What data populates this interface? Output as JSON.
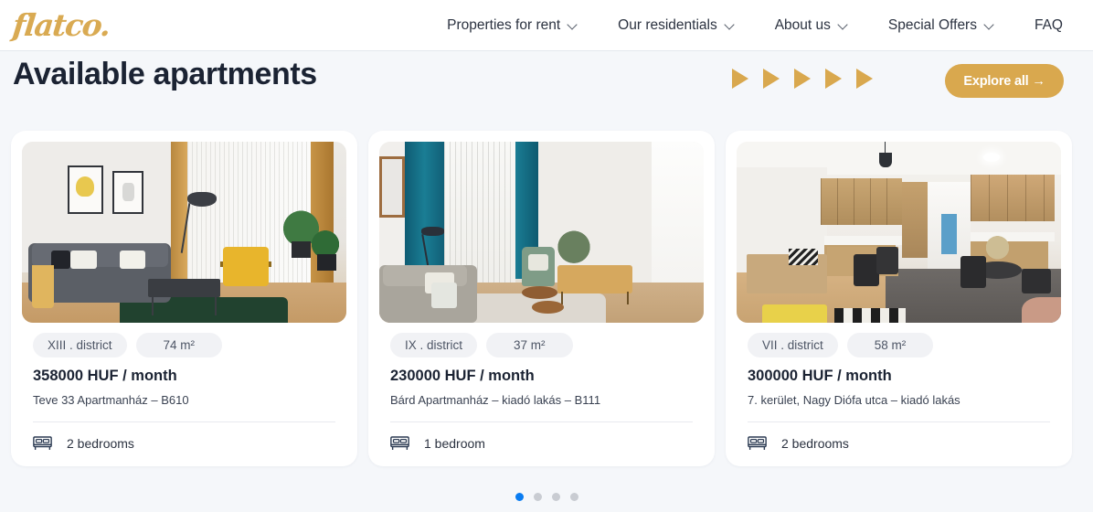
{
  "brand": {
    "logo_text": "flatco."
  },
  "nav": {
    "items": [
      {
        "label": "Properties for rent",
        "has_chevron": true
      },
      {
        "label": "Our residentials",
        "has_chevron": true
      },
      {
        "label": "About us",
        "has_chevron": true
      },
      {
        "label": "Special Offers",
        "has_chevron": true
      },
      {
        "label": "FAQ",
        "has_chevron": false
      }
    ]
  },
  "header": {
    "title": "Available apartments",
    "explore_label": "Explore all →",
    "arrow_count": 5,
    "accent_color": "#d9a84e"
  },
  "cards": [
    {
      "district": "XIII . district",
      "area": "74 m²",
      "price": "358000 HUF / month",
      "subtitle": "Teve 33 Apartmanház – B610",
      "bedrooms": "2 bedrooms",
      "photo_alt": "living room with gray sofa and yellow armchair"
    },
    {
      "district": "IX . district",
      "area": "37 m²",
      "price": "230000 HUF / month",
      "subtitle": "Bárd Apartmanház – kiadó lakás – B111",
      "bedrooms": "1 bedroom",
      "photo_alt": "living room with teal curtains and beige sofa"
    },
    {
      "district": "VII . district",
      "area": "58 m²",
      "price": "300000 HUF / month",
      "subtitle": "7. kerület, Nagy Diófa utca – kiadó lakás",
      "bedrooms": "2 bedrooms",
      "photo_alt": "open kitchen with wooden cabinets and dining table"
    }
  ],
  "pagination": {
    "total": 4,
    "active_index": 0,
    "active_color": "#0a7cf1",
    "inactive_color": "#c9ccd2"
  }
}
